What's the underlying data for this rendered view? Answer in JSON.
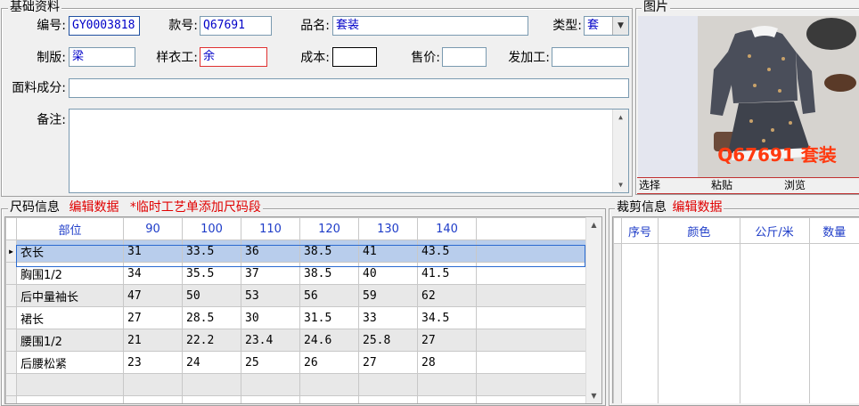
{
  "basic": {
    "legend": "基础资料",
    "code_label": "编号:",
    "code_value": "GY0003818",
    "style_label": "款号:",
    "style_value": "Q67691",
    "name_label": "品名:",
    "name_value": "套装",
    "type_label": "类型:",
    "type_value": "套",
    "pattern_label": "制版:",
    "pattern_value": "梁",
    "sample_label": "样衣工:",
    "sample_value": "余",
    "cost_label": "成本:",
    "cost_value": "",
    "price_label": "售价:",
    "price_value": "",
    "process_label": "发加工:",
    "process_value": "",
    "fabric_label": "面料成分:",
    "fabric_value": "",
    "remark_label": "备注:",
    "remark_value": ""
  },
  "picture": {
    "legend": "图片",
    "overlay_text": "Q67691 套装",
    "buttons": [
      "选择",
      "粘贴",
      "浏览"
    ]
  },
  "size": {
    "legend": "尺码信息",
    "edit_link": "编辑数据",
    "note": "*临时工艺单添加尺码段",
    "columns": [
      "部位",
      "90",
      "100",
      "110",
      "120",
      "130",
      "140"
    ],
    "rows": [
      [
        "衣长",
        "31",
        "33.5",
        "36",
        "38.5",
        "41",
        "43.5"
      ],
      [
        "胸围1/2",
        "34",
        "35.5",
        "37",
        "38.5",
        "40",
        "41.5"
      ],
      [
        "后中量袖长",
        "47",
        "50",
        "53",
        "56",
        "59",
        "62"
      ],
      [
        "裙长",
        "27",
        "28.5",
        "30",
        "31.5",
        "33",
        "34.5"
      ],
      [
        "腰围1/2",
        "21",
        "22.2",
        "23.4",
        "24.6",
        "25.8",
        "27"
      ],
      [
        "后腰松紧",
        "23",
        "24",
        "25",
        "26",
        "27",
        "28"
      ]
    ],
    "selected_row": 0
  },
  "cut": {
    "legend": "裁剪信息",
    "edit_link": "编辑数据",
    "columns": [
      "序号",
      "颜色",
      "公斤/米",
      "数量"
    ]
  }
}
